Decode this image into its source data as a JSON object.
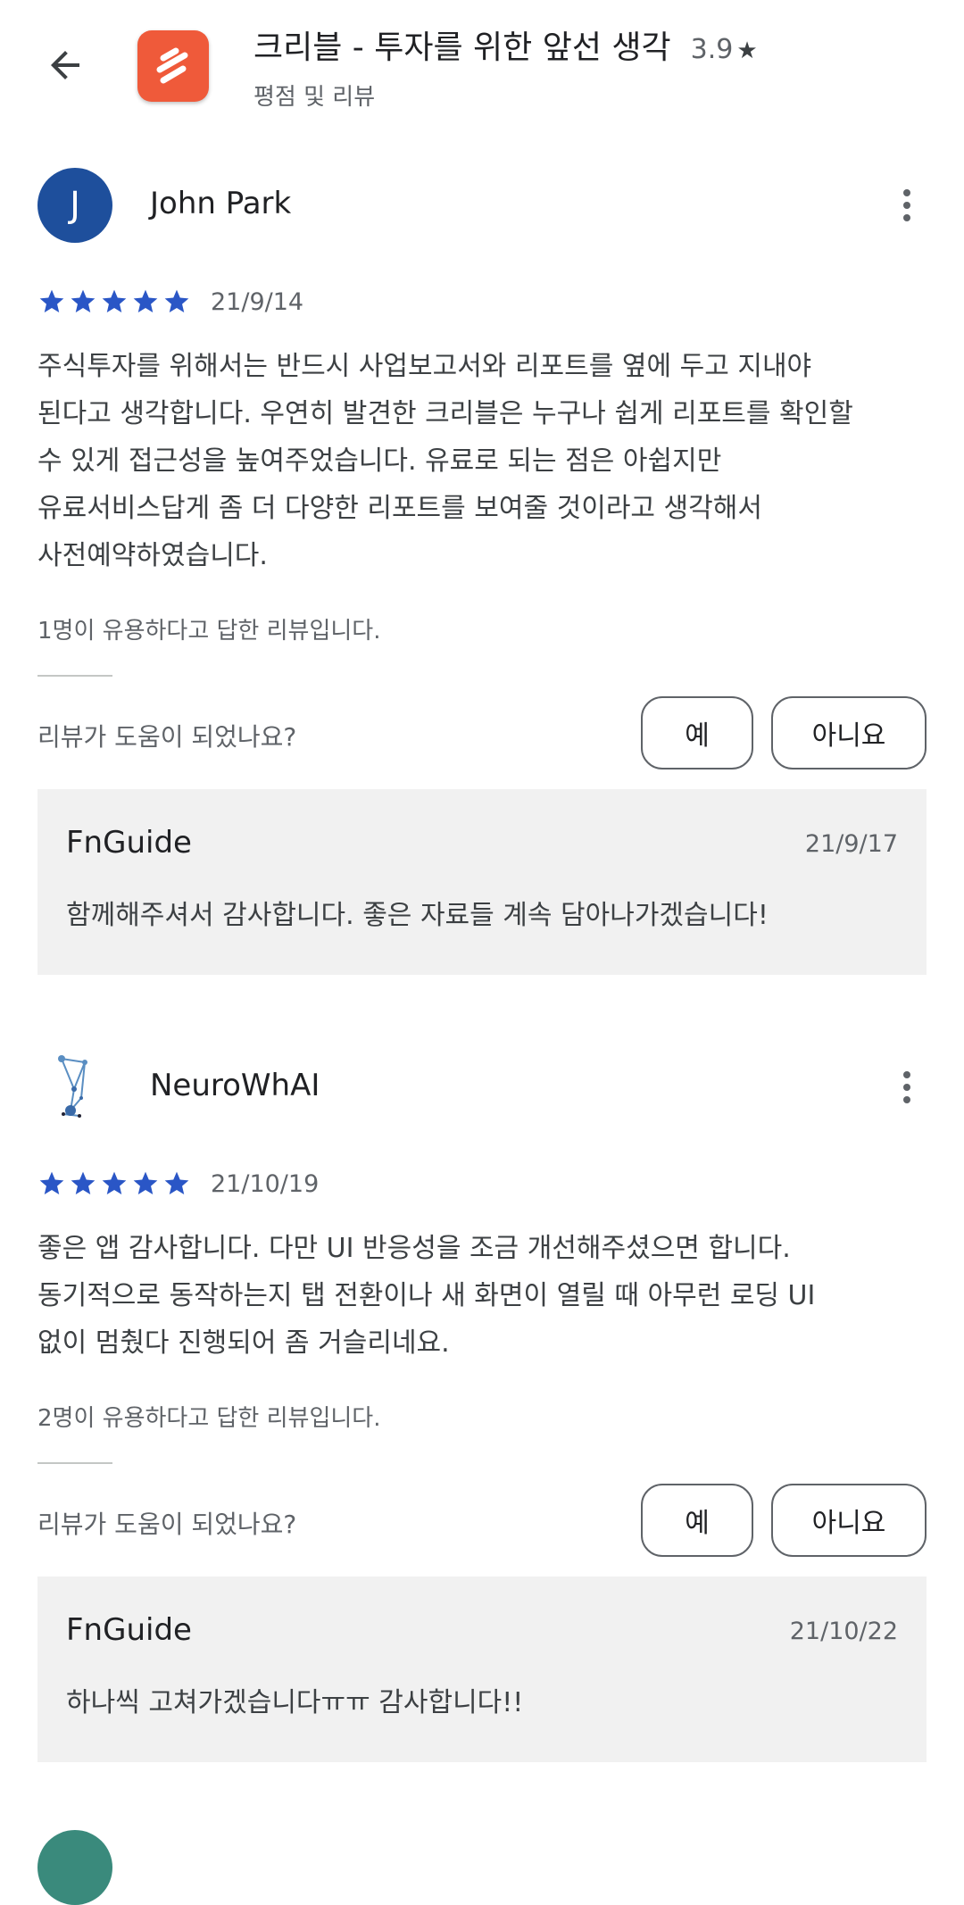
{
  "header": {
    "app_title": "크리블 - 투자를 위한 앞선 생각",
    "rating": "3.9",
    "rating_star": "★",
    "subtitle": "평점 및 리뷰"
  },
  "reviews": [
    {
      "avatar_letter": "J",
      "name": "John Park",
      "stars": 5,
      "date": "21/9/14",
      "text_lines": [
        "주식투자를 위해서는 반드시 사업보고서와 리포트를 옆에 두고 지내야",
        "된다고 생각합니다. 우연히 발견한 크리블은 누구나 쉽게 리포트를 확인할",
        "수 있게 접근성을 높여주었습니다. 유료로 되는 점은 아쉽지만",
        "유료서비스답게 좀 더 다양한 리포트를 보여줄 것이라고 생각해서",
        "사전예약하였습니다."
      ],
      "helpful_count": "1명이 유용하다고 답한 리뷰입니다.",
      "helpful_question": "리뷰가 도움이 되었나요?",
      "yes_label": "예",
      "no_label": "아니요",
      "reply": {
        "author": "FnGuide",
        "date": "21/9/17",
        "text": "함께해주셔서 감사합니다. 좋은 자료들 계속 담아나가겠습니다!"
      }
    },
    {
      "avatar_letter": "",
      "name": "NeuroWhAI",
      "stars": 5,
      "date": "21/10/19",
      "text_lines": [
        "좋은 앱 감사합니다. 다만 UI 반응성을 조금 개선해주셨으면 합니다.",
        "동기적으로 동작하는지 탭 전환이나 새 화면이 열릴 때 아무런 로딩 UI",
        "없이 멈췄다 진행되어 좀 거슬리네요."
      ],
      "helpful_count": "2명이 유용하다고 답한 리뷰입니다.",
      "helpful_question": "리뷰가 도움이 되었나요?",
      "yes_label": "예",
      "no_label": "아니요",
      "reply": {
        "author": "FnGuide",
        "date": "21/10/22",
        "text": "하나씩 고쳐가겠습니다ㅠㅠ 감사합니다!!"
      }
    }
  ],
  "colors": {
    "star": "#2a56c6",
    "app_icon": "#ef5a3a",
    "avatar_j": "#1e4f9c"
  },
  "icons": {
    "back": "arrow-back-icon",
    "more": "more-vert-icon",
    "star": "star-icon"
  }
}
